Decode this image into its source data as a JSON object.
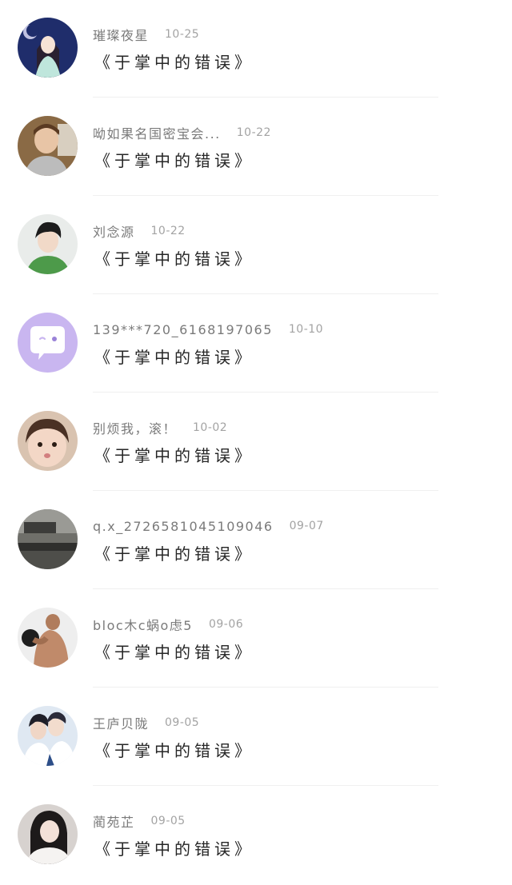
{
  "comments": [
    {
      "username": "璀璨夜星",
      "time": "10-25",
      "title": "《于掌中的错误》",
      "avatar": "anime-girl-avatar"
    },
    {
      "username": "呦如果名国密宝会...",
      "time": "10-22",
      "title": "《于掌中的错误》",
      "avatar": "boy-photo-avatar"
    },
    {
      "username": "刘念源",
      "time": "10-22",
      "title": "《于掌中的错误》",
      "avatar": "young-man-avatar"
    },
    {
      "username": "139***720_6168197065",
      "time": "10-10",
      "title": "《于掌中的错误》",
      "avatar": "default-chat-avatar"
    },
    {
      "username": "别烦我，滚！",
      "time": "10-02",
      "title": "《于掌中的错误》",
      "avatar": "kid-avatar"
    },
    {
      "username": "q.x_2726581045109046",
      "time": "09-07",
      "title": "《于掌中的错误》",
      "avatar": "room-photo-avatar"
    },
    {
      "username": "bloc木c蜗o虑5",
      "time": "09-06",
      "title": "《于掌中的错误》",
      "avatar": "fitness-avatar"
    },
    {
      "username": "王庐贝陇",
      "time": "09-05",
      "title": "《于掌中的错误》",
      "avatar": "couple-avatar"
    },
    {
      "username": "蔺苑芷",
      "time": "09-05",
      "title": "《于掌中的错误》",
      "avatar": "girl-photo-avatar"
    }
  ],
  "colors": {
    "background": "#ffffff",
    "username": "#7a7a7a",
    "time": "#a3a3a3",
    "title": "#262626",
    "divider": "#f0f0f0",
    "default_avatar": "#c9b6f0"
  }
}
